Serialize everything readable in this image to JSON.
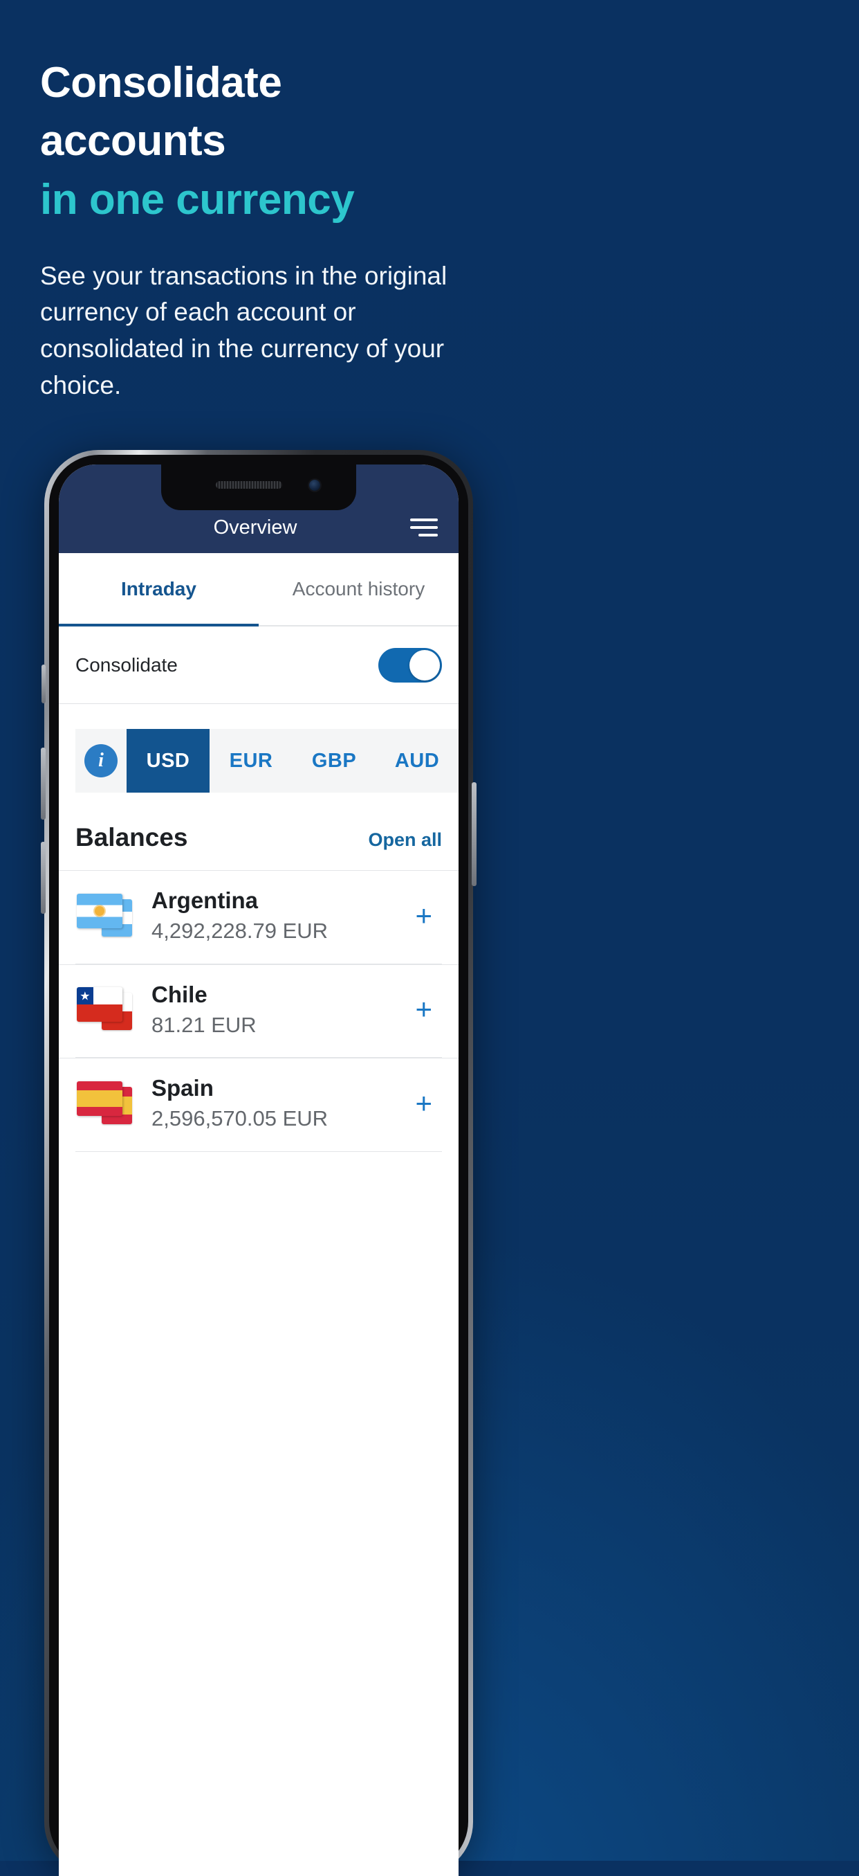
{
  "promo": {
    "headline_line1": "Consolidate",
    "headline_line2": "accounts",
    "headline_accent": "in one currency",
    "subcopy": "See your transactions in the original currency of each account or consolidated in the currency of your choice.",
    "colors": {
      "background": "#0a3161",
      "accent": "#2dc6cd",
      "text": "#ffffff"
    }
  },
  "app": {
    "header": {
      "title": "Overview",
      "menu_icon": "hamburger-menu-icon",
      "background": "#243760"
    },
    "tabs": [
      {
        "label": "Intraday",
        "active": true
      },
      {
        "label": "Account history",
        "active": false
      }
    ],
    "consolidate": {
      "label": "Consolidate",
      "toggle_on": true,
      "toggle_color": "#1169b0"
    },
    "currency_selector": {
      "info_icon": "info-circle-icon",
      "options": [
        {
          "code": "USD",
          "active": true
        },
        {
          "code": "EUR",
          "active": false
        },
        {
          "code": "GBP",
          "active": false
        },
        {
          "code": "AUD",
          "active": false
        }
      ],
      "active_color": "#12548f",
      "link_color": "#1a77c4"
    },
    "balances": {
      "title": "Balances",
      "open_all_label": "Open all",
      "expand_icon": "plus-icon",
      "rows": [
        {
          "country": "Argentina",
          "amount": "4,292,228.79 EUR",
          "flag": "argentina-flag-icon"
        },
        {
          "country": "Chile",
          "amount": "81.21 EUR",
          "flag": "chile-flag-icon"
        },
        {
          "country": "Spain",
          "amount": "2,596,570.05 EUR",
          "flag": "spain-flag-icon"
        }
      ]
    }
  }
}
